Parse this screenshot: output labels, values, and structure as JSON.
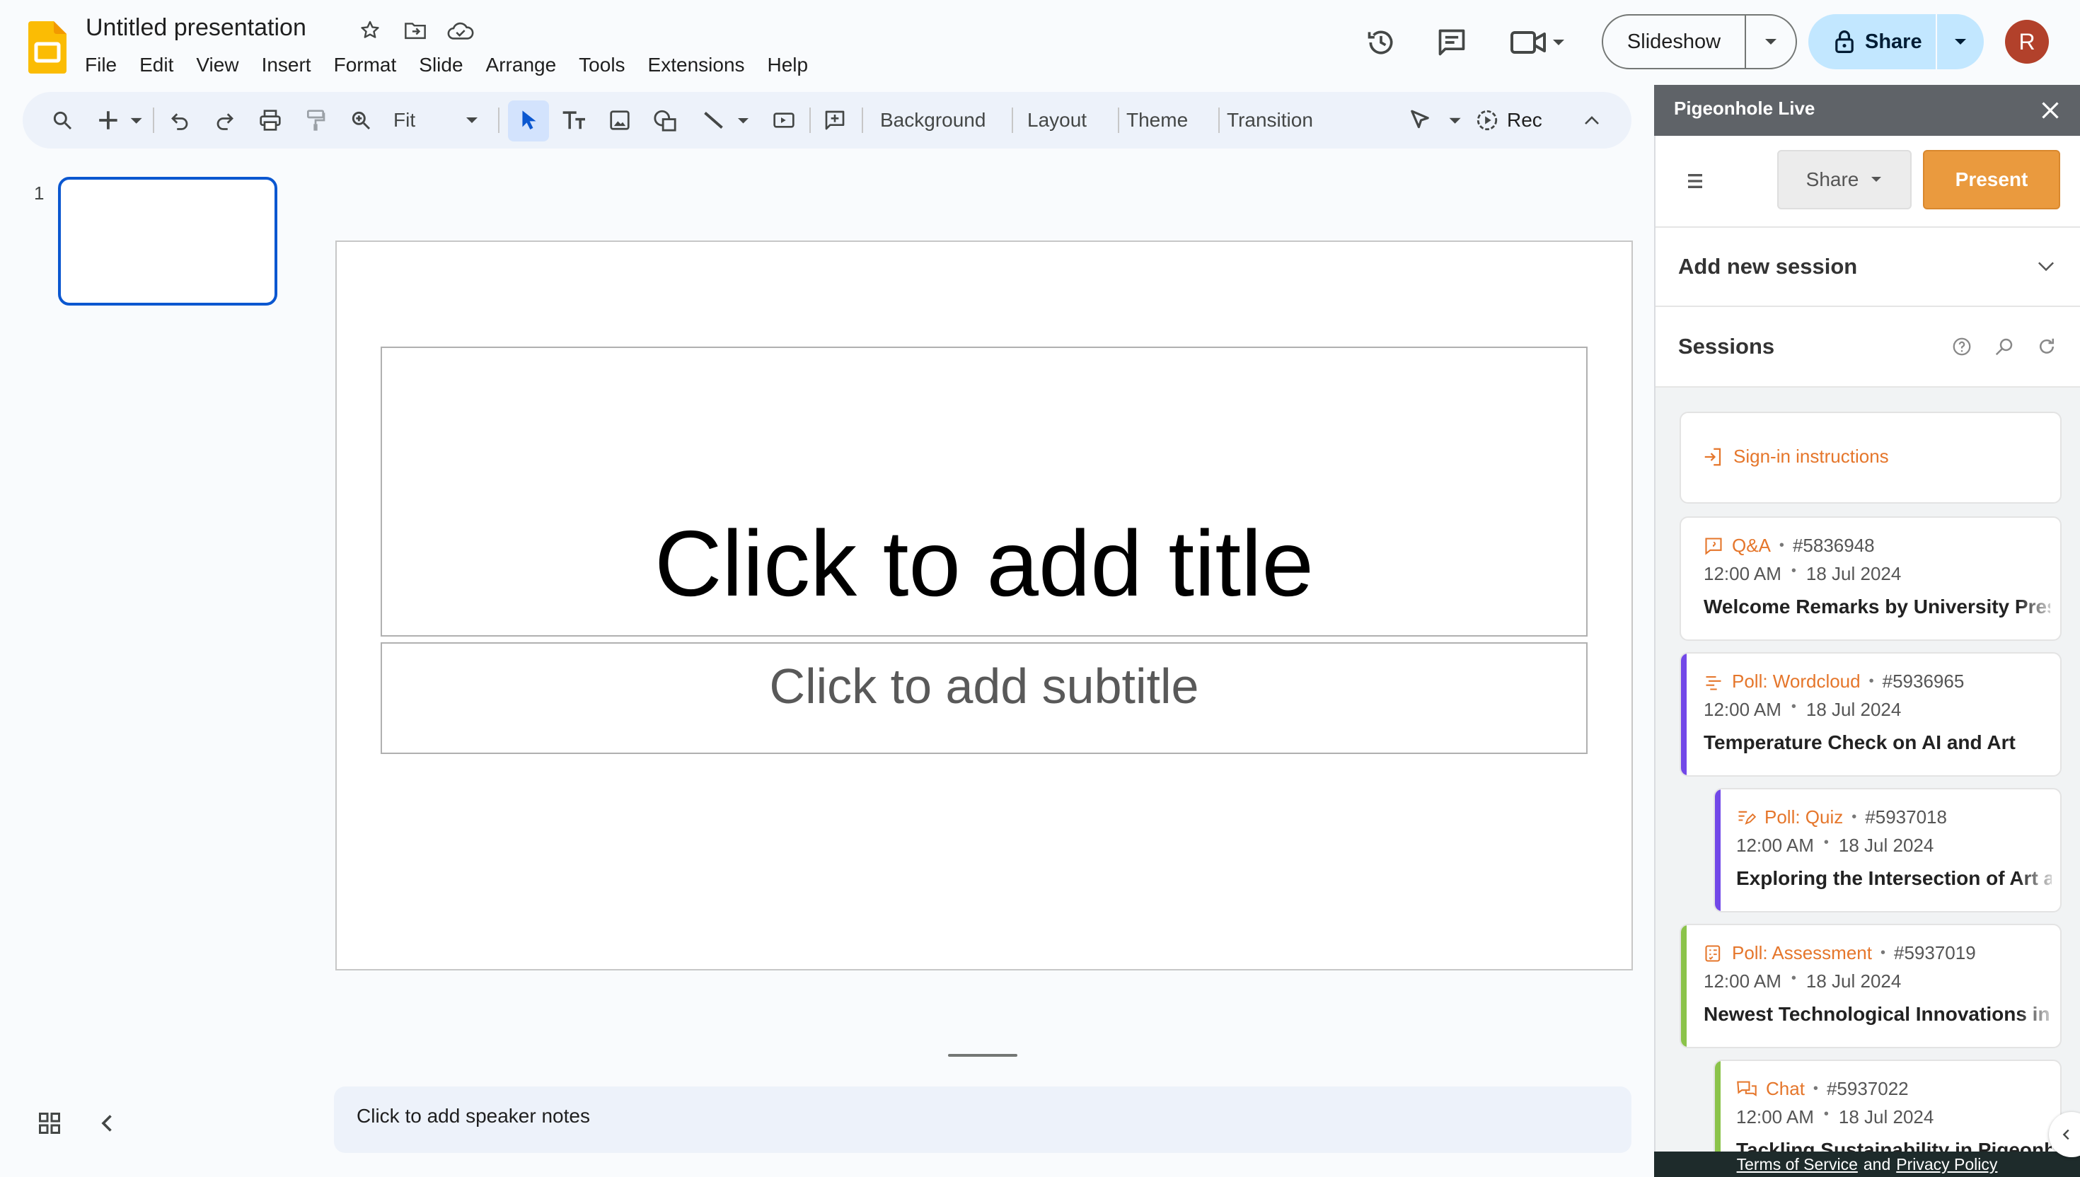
{
  "app": {
    "doc_title": "Untitled presentation",
    "menu": [
      "File",
      "Edit",
      "View",
      "Insert",
      "Format",
      "Slide",
      "Arrange",
      "Tools",
      "Extensions",
      "Help"
    ],
    "slideshow_label": "Slideshow",
    "share_label": "Share",
    "avatar_initial": "R",
    "brand_color": "#fbbc04",
    "accent_color": "#0b57d0"
  },
  "toolbar": {
    "zoom_value": "Fit",
    "background": "Background",
    "layout": "Layout",
    "theme": "Theme",
    "transition": "Transition",
    "rec": "Rec"
  },
  "filmstrip": {
    "slide_number": "1"
  },
  "slide": {
    "title_placeholder": "Click to add title",
    "subtitle_placeholder": "Click to add subtitle"
  },
  "notes": {
    "placeholder": "Click to add speaker notes"
  },
  "panel": {
    "title": "Pigeonhole Live",
    "share_label": "Share",
    "present_label": "Present",
    "add_session": "Add new session",
    "sessions_heading": "Sessions",
    "signin_label": "Sign-in instructions",
    "sessions": [
      {
        "type": "Q&A",
        "id": "#5836948",
        "time": "12:00 AM",
        "date": "18 Jul 2024",
        "title": "Welcome Remarks by University Pres",
        "bar_color": "",
        "icon": "qa-icon"
      },
      {
        "type": "Poll: Wordcloud",
        "id": "#5936965",
        "time": "12:00 AM",
        "date": "18 Jul 2024",
        "title": "Temperature Check on AI and Art",
        "bar_color": "#7248e8",
        "icon": "wordcloud-icon"
      },
      {
        "type": "Poll: Quiz",
        "id": "#5937018",
        "time": "12:00 AM",
        "date": "18 Jul 2024",
        "title": "Exploring the Intersection of Art a",
        "bar_color": "#7248e8",
        "icon": "quiz-icon"
      },
      {
        "type": "Poll: Assessment",
        "id": "#5937019",
        "time": "12:00 AM",
        "date": "18 Jul 2024",
        "title": "Newest Technological Innovations in",
        "bar_color": "#8bc34a",
        "icon": "assessment-icon"
      },
      {
        "type": "Chat",
        "id": "#5937022",
        "time": "12:00 AM",
        "date": "18 Jul 2024",
        "title": "Tackling Sustainability in Pigeonh",
        "bar_color": "#8bc34a",
        "icon": "chat-icon"
      }
    ],
    "footer": {
      "terms": "Terms of Service",
      "and": "and",
      "privacy": "Privacy Policy"
    }
  }
}
